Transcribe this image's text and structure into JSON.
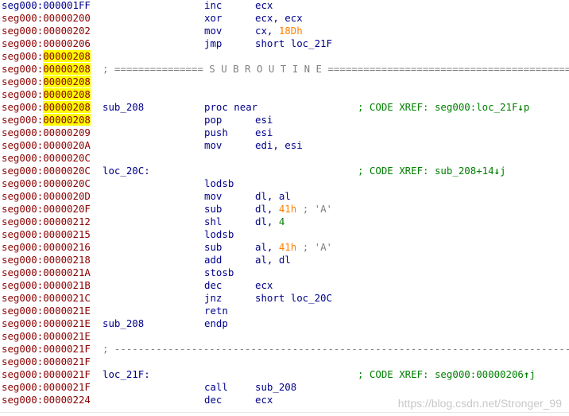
{
  "colors": {
    "seg_code": "#8b0000",
    "seg_data": "#00008b",
    "highlight": "#ffff00",
    "mnemonic": "#00008b",
    "number": "#ff8000",
    "comment": "#008000"
  },
  "rows": [
    {
      "seg": "seg000:",
      "addr": "000001FF",
      "mn": "inc",
      "ops": "ecx"
    },
    {
      "seg": "seg000:",
      "addr": "00000200",
      "mn": "xor",
      "ops": "ecx, ecx"
    },
    {
      "seg": "seg000:",
      "addr": "00000202",
      "mn": "mov",
      "ops_pre": "cx, ",
      "ops_num": "18Dh"
    },
    {
      "seg": "seg000:",
      "addr": "00000206",
      "mn": "jmp",
      "ops": "short loc_21F"
    },
    {
      "seg": "seg000:",
      "addr": "00000208",
      "hl": true
    },
    {
      "seg": "seg000:",
      "addr": "00000208",
      "hl": true,
      "sep": "; =============== S U B R O U T I N E ======================================================================"
    },
    {
      "seg": "seg000:",
      "addr": "00000208",
      "hl": true
    },
    {
      "seg": "seg000:",
      "addr": "00000208",
      "hl": true
    },
    {
      "seg": "seg000:",
      "addr": "00000208",
      "hl": true,
      "label": "sub_208",
      "mn": "proc near",
      "comment": "; CODE XREF: seg000:loc_21F",
      "arrow": "↓",
      "suffix": "p"
    },
    {
      "seg": "seg000:",
      "addr": "00000208",
      "hl": true,
      "mn": "pop",
      "ops": "esi"
    },
    {
      "seg": "seg000:",
      "addr": "00000209",
      "mn": "push",
      "ops": "esi"
    },
    {
      "seg": "seg000:",
      "addr": "0000020A",
      "mn": "mov",
      "ops": "edi, esi"
    },
    {
      "seg": "seg000:",
      "addr": "0000020C"
    },
    {
      "seg": "seg000:",
      "addr": "0000020C",
      "label": "loc_20C:",
      "comment": "; CODE XREF: sub_208+14",
      "arrow": "↓",
      "suffix": "j"
    },
    {
      "seg": "seg000:",
      "addr": "0000020C",
      "mn": "lodsb"
    },
    {
      "seg": "seg000:",
      "addr": "0000020D",
      "mn": "mov",
      "ops": "dl, al"
    },
    {
      "seg": "seg000:",
      "addr": "0000020F",
      "mn": "sub",
      "ops_pre": "dl, ",
      "ops_num": "41h",
      "ops_cm": " ; 'A'"
    },
    {
      "seg": "seg000:",
      "addr": "00000212",
      "mn": "shl",
      "ops_pre": "dl, ",
      "ops_dig": "4"
    },
    {
      "seg": "seg000:",
      "addr": "00000215",
      "mn": "lodsb"
    },
    {
      "seg": "seg000:",
      "addr": "00000216",
      "mn": "sub",
      "ops_pre": "al, ",
      "ops_num": "41h",
      "ops_cm": " ; 'A'"
    },
    {
      "seg": "seg000:",
      "addr": "00000218",
      "mn": "add",
      "ops": "al, dl"
    },
    {
      "seg": "seg000:",
      "addr": "0000021A",
      "mn": "stosb"
    },
    {
      "seg": "seg000:",
      "addr": "0000021B",
      "mn": "dec",
      "ops": "ecx"
    },
    {
      "seg": "seg000:",
      "addr": "0000021C",
      "mn": "jnz",
      "ops": "short loc_20C"
    },
    {
      "seg": "seg000:",
      "addr": "0000021E",
      "mn": "retn"
    },
    {
      "seg": "seg000:",
      "addr": "0000021E",
      "label": "sub_208",
      "mn": "endp"
    },
    {
      "seg": "seg000:",
      "addr": "0000021E"
    },
    {
      "seg": "seg000:",
      "addr": "0000021F",
      "code": true,
      "sep": "; -----------------------------------------------------------------------------------------------------------"
    },
    {
      "seg": "seg000:",
      "addr": "0000021F",
      "code": true
    },
    {
      "seg": "seg000:",
      "addr": "0000021F",
      "code": true,
      "label": "loc_21F:",
      "comment": "; CODE XREF: seg000:00000206",
      "arrow": "↑",
      "suffix": "j"
    },
    {
      "seg": "seg000:",
      "addr": "0000021F",
      "code": true,
      "mn": "call",
      "ops": "sub_208"
    },
    {
      "seg": "seg000:",
      "addr": "00000224",
      "code": true,
      "mn": "dec",
      "ops": "ecx"
    }
  ],
  "watermark": "https://blog.csdn.net/Stronger_99"
}
